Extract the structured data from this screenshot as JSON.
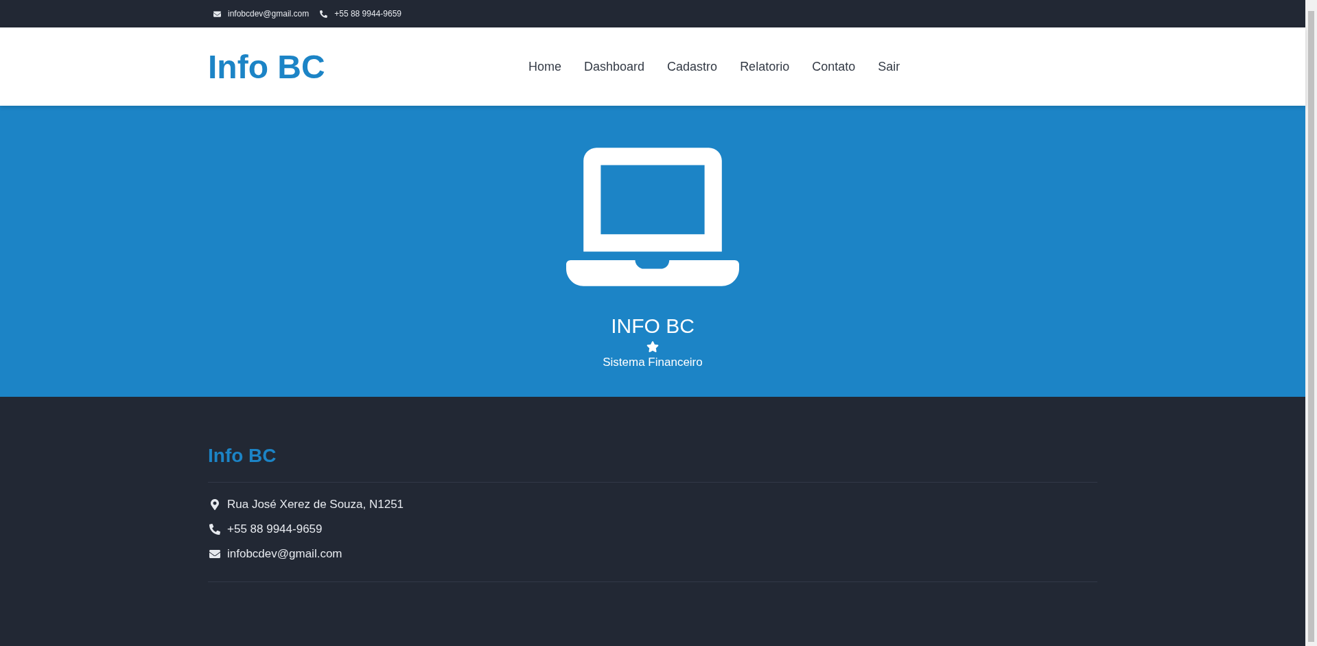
{
  "top_bar": {
    "email": "infobcdev@gmail.com",
    "phone": "+55 88 9944-9659"
  },
  "header": {
    "logo": "Info BC",
    "nav": [
      "Home",
      "Dashboard",
      "Cadastro",
      "Relatorio",
      "Contato",
      "Sair"
    ]
  },
  "hero": {
    "title": "INFO BC",
    "subtitle": "Sistema Financeiro"
  },
  "footer": {
    "heading": "Info BC",
    "contacts": [
      {
        "kind": "address",
        "text": "Rua José Xerez de Souza, N1251"
      },
      {
        "kind": "phone",
        "text": "+55 88 9944-9659"
      },
      {
        "kind": "email",
        "text": "infobcdev@gmail.com"
      }
    ]
  }
}
